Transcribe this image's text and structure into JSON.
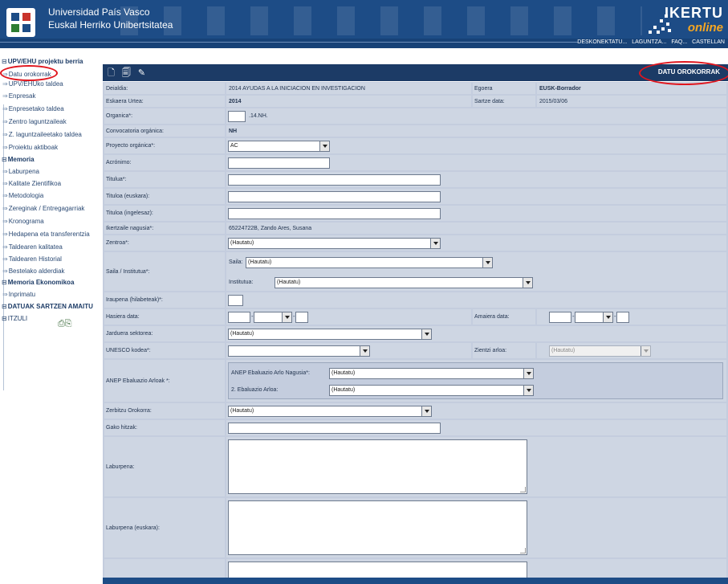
{
  "header": {
    "university_es": "Universidad País Vasco",
    "university_eu": "Euskal Herriko Unibertsitatea",
    "brand": "IKERTU",
    "brand_sub": "online",
    "links": [
      "DESKONEKTATU...",
      "LAGUNTZA...",
      "FAQ...",
      "CASTELLAN"
    ]
  },
  "sidebar": {
    "groups": [
      {
        "label": "UPV/EHU projektu berria",
        "items": [
          "Datu orokorrak",
          "UPV/EHUko taldea",
          "Enpresak",
          "Enpresetako taldea",
          "Zentro laguntzaileak",
          "Z. laguntzaileetako taldea",
          "Proiektu aktiboak"
        ]
      },
      {
        "label": "Memoria",
        "items": [
          "Laburpena",
          "Kalitate Zientifikoa",
          "Metodologia",
          "Zereginak / Entregagarriak",
          "Kronograma",
          "Hedapena eta transferentzia",
          "Taldearen kalitatea",
          "Taldearen Historial",
          "Bestelako alderdiak"
        ]
      },
      {
        "label": "Memoria Ekonomikoa",
        "items": [
          "Inprimatu"
        ]
      },
      {
        "label": "DATUAK SARTZEN AMAITU",
        "items": []
      }
    ],
    "itzuli": "ITZULI"
  },
  "toolbar": {
    "title": "DATU OROKORRAK",
    "icons": [
      "new-doc-icon",
      "save-doc-icon",
      "edit-icon"
    ]
  },
  "form": {
    "deialdia_label": "Deialdia:",
    "deialdia_value": "2014 AYUDAS A LA INICIACION EN INVESTIGACION",
    "egoera_label": "Egoera",
    "egoera_value": "EUSK-Borrador",
    "eskaera_urtea_label": "Eskaera Urtea:",
    "eskaera_urtea_value": "2014",
    "sartze_data_label": "Sartze data:",
    "sartze_data_value": "2015/03/06",
    "organica_label": "Organica*:",
    "organica_suffix": ".14.NH.",
    "convocatoria_label": "Convocatoria orgánica:",
    "convocatoria_value": "NH",
    "proyecto_label": "Proyecto orgánica*:",
    "proyecto_value": "AC",
    "acronimo_label": "Acrónimo:",
    "titulua_label": "Titulua*:",
    "tituloa_eu_label": "Tituloa (euskara):",
    "tituloa_en_label": "Tituloa (ingelesaz):",
    "ikertzaile_label": "Ikertzaile nagusia*:",
    "ikertzaile_value": "65224722B, Zando Ares, Susana",
    "zentroa_label": "Zentroa*:",
    "zentroa_value": "(Hautatu)",
    "saila_label": "Saila / Institutua*:",
    "saila_sub": "Saila:",
    "saila_value": "(Hautatu)",
    "institutua_sub": "Institutua:",
    "institutua_value": "(Hautatu)",
    "iraupena_label": "Iraupena (hilabeteak)*:",
    "hasiera_label": "Hasiera data:",
    "amaiera_label": "Amaiera data:",
    "jarduera_label": "Jarduera sektorea:",
    "jarduera_value": "(Hautatu)",
    "unesco_label": "UNESCO kodea*:",
    "zientzi_label": "Zientzi arloa:",
    "zientzi_value": "(Hautatu)",
    "anep_label": "ANEP Ebaluazio Arloak *:",
    "anep_nagusia_label": "ANEP Ebaluazio Arlo Nagusia*:",
    "anep_nagusia_value": "(Hautatu)",
    "anep_2_label": "2. Ebaluazio Arloa:",
    "anep_2_value": "(Hautatu)",
    "zerbitzu_label": "Zerbitzu Orokorra:",
    "zerbitzu_value": "(Hautatu)",
    "gako_label": "Gako hitzak:",
    "laburpena_label": "Laburpena:",
    "laburpena_eu_label": "Laburpena (euskara):"
  },
  "annotation_color": "#e0161e"
}
